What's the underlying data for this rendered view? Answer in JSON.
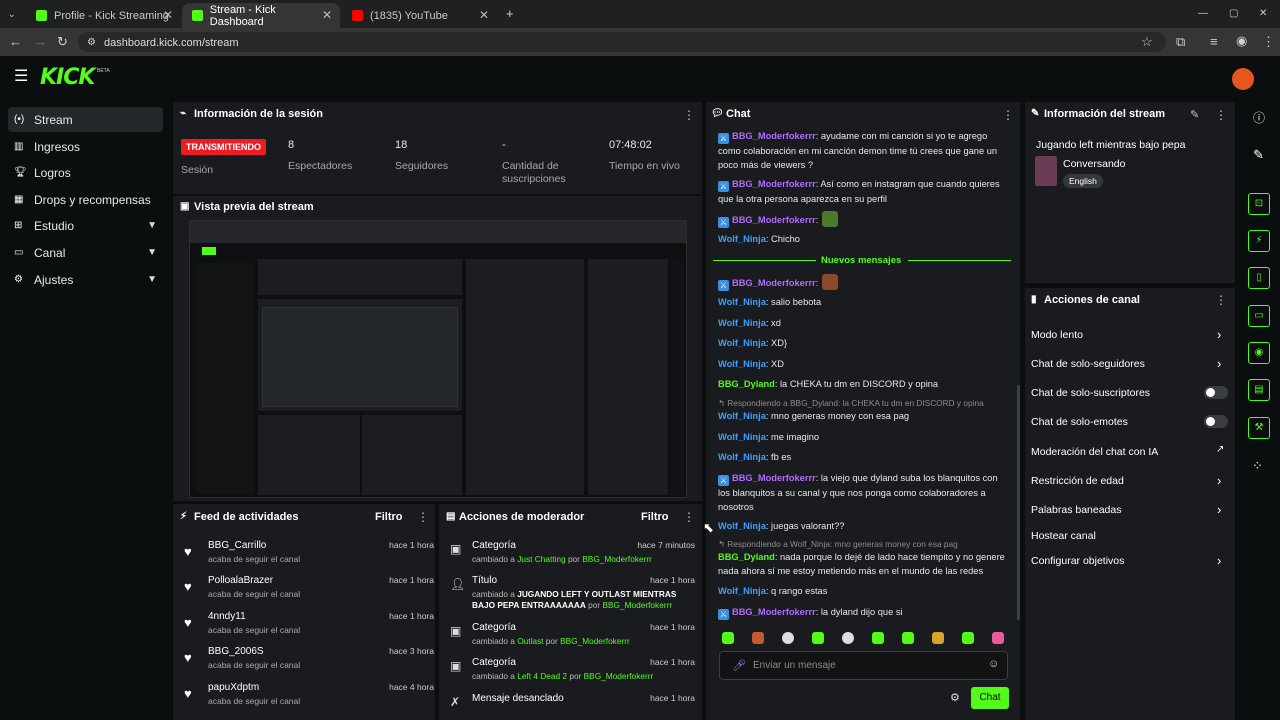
{
  "browser": {
    "tabs": [
      {
        "label": "Profile - Kick Streaming"
      },
      {
        "label": "Stream - Kick Dashboard"
      },
      {
        "label": "(1835) YouTube"
      }
    ],
    "url": "dashboard.kick.com/stream"
  },
  "header": {
    "logo": "KICK",
    "beta": "BETA"
  },
  "sidebar": {
    "items": [
      {
        "label": "Stream",
        "icon": "broadcast-icon"
      },
      {
        "label": "Ingresos",
        "icon": "bars-icon"
      },
      {
        "label": "Logros",
        "icon": "trophy-icon"
      },
      {
        "label": "Drops y recompensas",
        "icon": "gift-icon"
      },
      {
        "label": "Estudio",
        "icon": "grid-icon"
      },
      {
        "label": "Canal",
        "icon": "monitor-icon"
      },
      {
        "label": "Ajustes",
        "icon": "gear-icon"
      }
    ]
  },
  "session": {
    "title": "Información de la sesión",
    "live_label": "TRANSMITIENDO",
    "live_sub": "Sesión",
    "viewers": "8",
    "viewers_label": "Espectadores",
    "followers": "18",
    "followers_label": "Seguidores",
    "subs": "-",
    "subs_label": "Cantidad de suscripciones",
    "time": "07:48:02",
    "time_label": "Tiempo en vivo"
  },
  "preview": {
    "title": "Vista previa del stream"
  },
  "feed": {
    "title": "Feed de actividades",
    "filter": "Filtro",
    "items": [
      {
        "name": "BBG_Carrillo",
        "desc": "acaba de seguir el canal",
        "time": "hace 1 hora"
      },
      {
        "name": "PolloalaBrazer",
        "desc": "acaba de seguir el canal",
        "time": "hace 1 hora"
      },
      {
        "name": "4nndy11",
        "desc": "acaba de seguir el canal",
        "time": "hace 1 hora"
      },
      {
        "name": "BBG_2006S",
        "desc": "acaba de seguir el canal",
        "time": "hace 3 hora"
      },
      {
        "name": "papuXdptm",
        "desc": "acaba de seguir el canal",
        "time": "hace 4 hora"
      }
    ]
  },
  "mod": {
    "title": "Acciones de moderador",
    "filter": "Filtro",
    "items": [
      {
        "name": "Categoría",
        "pre": "cambiado a ",
        "val": "Just Chatting",
        "mid": " por ",
        "user": "BBG_Moderfokerrr",
        "time": "hace 7 minutos"
      },
      {
        "name": "Título",
        "pre": "cambiado a ",
        "val": "JUGANDO LEFT Y OUTLAST MIENTRAS BAJO PEPA ENTRAAAAAAA",
        "mid": " por ",
        "user": "BBG_Moderfokerrr",
        "time": "hace 1 hora"
      },
      {
        "name": "Categoría",
        "pre": "cambiado a ",
        "val": "Outlast",
        "mid": " por ",
        "user": "BBG_Moderfokerrr",
        "time": "hace 1 hora"
      },
      {
        "name": "Categoría",
        "pre": "cambiado a ",
        "val": "Left 4 Dead 2",
        "mid": " por ",
        "user": "BBG_Moderfokerrr",
        "time": "hace 1 hora"
      },
      {
        "name": "Mensaje desanclado",
        "pre": "",
        "val": "",
        "mid": "",
        "user": "",
        "time": "hace 1 hora"
      }
    ]
  },
  "chat": {
    "title": "Chat",
    "divider": "Nuevos mensajes",
    "messages": [
      {
        "user": "BBG_Moderfokerrr",
        "text": ": ayudame con mi canción si yo te agrego como colaboración en mi canción demon time tú crees que gane un poco más de viewers ?"
      },
      {
        "user": "BBG_Moderfokerrr",
        "text": ": Así como en instagram que cuando quieres que la otra persona aparezca en su perfil"
      },
      {
        "user": "BBG_Moderfokerrr",
        "text": ":"
      },
      {
        "user": "Wolf_Ninja",
        "text": ": Chicho"
      },
      {
        "user": "BBG_Moderfokerrr",
        "text": ":"
      },
      {
        "user": "Wolf_Ninja",
        "text": ": salio bebota"
      },
      {
        "user": "Wolf_Ninja",
        "text": ": xd"
      },
      {
        "user": "Wolf_Ninja",
        "text": ": XD}"
      },
      {
        "user": "Wolf_Ninja",
        "text": ": XD"
      },
      {
        "user": "BBG_Dyland",
        "text": ": la CHEKA tu dm en DISCORD y opina"
      },
      {
        "user": "Wolf_Ninja",
        "text": ": mno generas money con esa pag"
      },
      {
        "user": "Wolf_Ninja",
        "text": ": me imagino"
      },
      {
        "user": "Wolf_Ninja",
        "text": ": fb es"
      },
      {
        "user": "BBG_Moderfokerrr",
        "text": ": la viejo que dyland suba los blanquitos con los blanquitos a su canal y que nos ponga como colaboradores a nosotros"
      },
      {
        "user": "Wolf_Ninja",
        "text": ": juegas valorant??"
      },
      {
        "user": "BBG_Dyland",
        "text": ": nada porque lo dejé de lado hace tiempito y no genere nada ahora sí me estoy metiendo más en el mundo de las redes"
      },
      {
        "user": "Wolf_Ninja",
        "text": ": q rango estas"
      },
      {
        "user": "BBG_Moderfokerrr",
        "text": ": la dyland dijo que si"
      }
    ],
    "replies": [
      "Respondiendo a BBG_Dyland: la CHEKA tu dm en DISCORD y opina",
      "Respondiendo a Wolf_Ninja: mno generas money con esa pag"
    ],
    "input_placeholder": "Enviar un mensaje",
    "send_label": "Chat"
  },
  "stream_info": {
    "title": "Información del stream",
    "stream_title": "Jugando left mientras bajo pepa",
    "category": "Conversando",
    "language": "English"
  },
  "channel_actions": {
    "title": "Acciones de canal",
    "items": [
      {
        "label": "Modo lento"
      },
      {
        "label": "Chat de solo-seguidores"
      },
      {
        "label": "Chat de solo-suscriptores"
      },
      {
        "label": "Chat de solo-emotes"
      },
      {
        "label": "Moderación del chat con IA"
      },
      {
        "label": "Restricción de edad"
      },
      {
        "label": "Palabras baneadas"
      },
      {
        "label": "Hostear canal"
      },
      {
        "label": "Configurar objetivos"
      }
    ]
  },
  "colors": {
    "accent": "#53fc18",
    "live": "#ec1c24",
    "mod_badge": "#3b8fe0",
    "username_purple": "#b36bff",
    "username_blue": "#3fa0ff"
  }
}
